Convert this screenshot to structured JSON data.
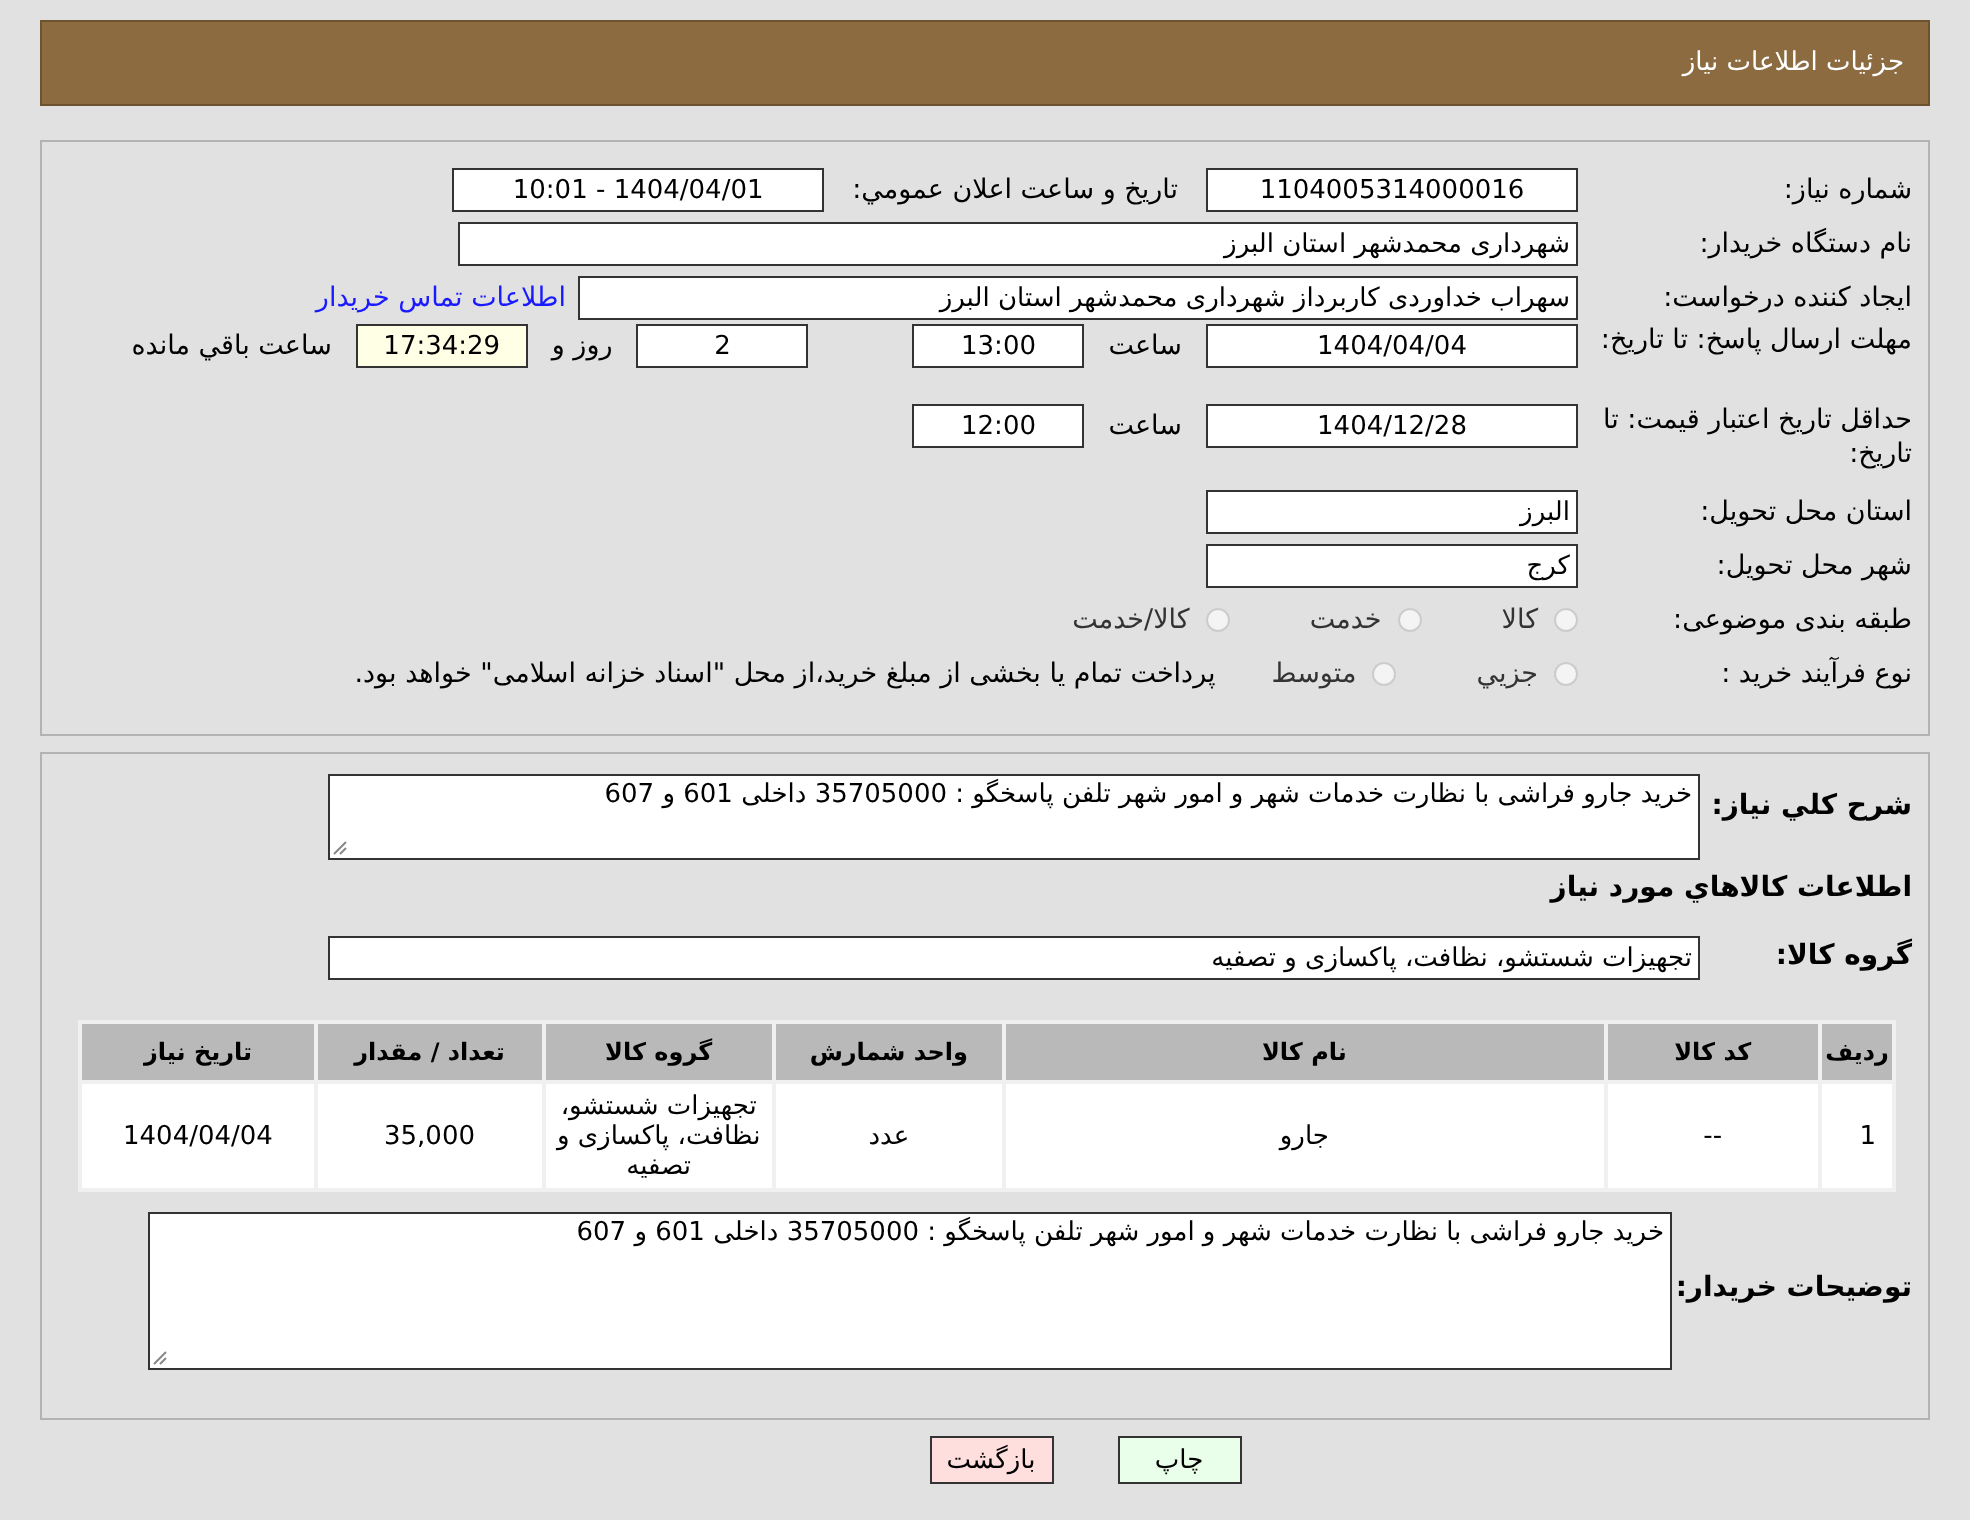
{
  "header": {
    "title": "جزئيات اطلاعات نياز"
  },
  "need_number": {
    "label": "شماره نياز:",
    "value": "1104005314000016"
  },
  "announce": {
    "label": "تاريخ و ساعت اعلان عمومي:",
    "value": "1404/04/01 - 10:01"
  },
  "buyer": {
    "label": "نام دستگاه خريدار:",
    "value": "شهرداری محمدشهر استان البرز"
  },
  "requester": {
    "label": "ايجاد كننده درخواست:",
    "value": "سهراب خداوردی کاربرداز شهرداری محمدشهر استان البرز",
    "link": "اطلاعات تماس خريدار"
  },
  "deadline": {
    "label": "مهلت ارسال پاسخ: تا تاريخ:",
    "date": "1404/04/04",
    "time_label": "ساعت",
    "time": "13:00",
    "days": "2",
    "days_label": "روز و",
    "remaining": "17:34:29",
    "remaining_label": "ساعت باقي مانده"
  },
  "validity": {
    "label": "حداقل تاريخ اعتبار قيمت: تا تاريخ:",
    "date": "1404/12/28",
    "time_label": "ساعت",
    "time": "12:00"
  },
  "province": {
    "label": "استان محل تحويل:",
    "value": "البرز"
  },
  "city": {
    "label": "شهر محل تحويل:",
    "value": "کرج"
  },
  "category": {
    "label": "طبقه بندی موضوعی:",
    "options": [
      {
        "label": "كالا",
        "selected": false
      },
      {
        "label": "خدمت",
        "selected": false
      },
      {
        "label": "كالا/خدمت",
        "selected": false
      }
    ]
  },
  "purchase_type": {
    "label": "نوع فرآيند خريد :",
    "options": [
      {
        "label": "جزيي",
        "selected": false
      },
      {
        "label": "متوسط",
        "selected": false
      }
    ],
    "note": "پرداخت تمام يا بخشی از مبلغ خريد،از محل \"اسناد خزانه اسلامی\" خواهد بود."
  },
  "description": {
    "label": "شرح كلي نياز:",
    "value": "خريد جارو فراشی با نظارت خدمات شهر و امور شهر تلفن پاسخگو : 35705000 داخلی 601 و 607"
  },
  "goods_title": "اطلاعات كالاهاي مورد نياز",
  "goods_group": {
    "label": "گروه كالا:",
    "value": "تجهيزات شستشو، نظافت، پاكسازی و تصفيه"
  },
  "table": {
    "columns": [
      "رديف",
      "كد كالا",
      "نام كالا",
      "واحد شمارش",
      "گروه كالا",
      "تعداد / مقدار",
      "تاريخ نياز"
    ],
    "rows": [
      [
        "1",
        "--",
        "جارو",
        "عدد",
        "تجهيزات شستشو، نظافت، پاكسازی و تصفيه",
        "35,000",
        "1404/04/04"
      ]
    ]
  },
  "buyer_notes": {
    "label": "توضيحات خريدار:",
    "value": "خريد جارو فراشی با نظارت خدمات شهر و امور شهر تلفن پاسخگو : 35705000 داخلی 601 و 607"
  },
  "buttons": [
    {
      "label": "چاپ",
      "kind": "print"
    },
    {
      "label": "بازگشت",
      "kind": "back"
    }
  ]
}
